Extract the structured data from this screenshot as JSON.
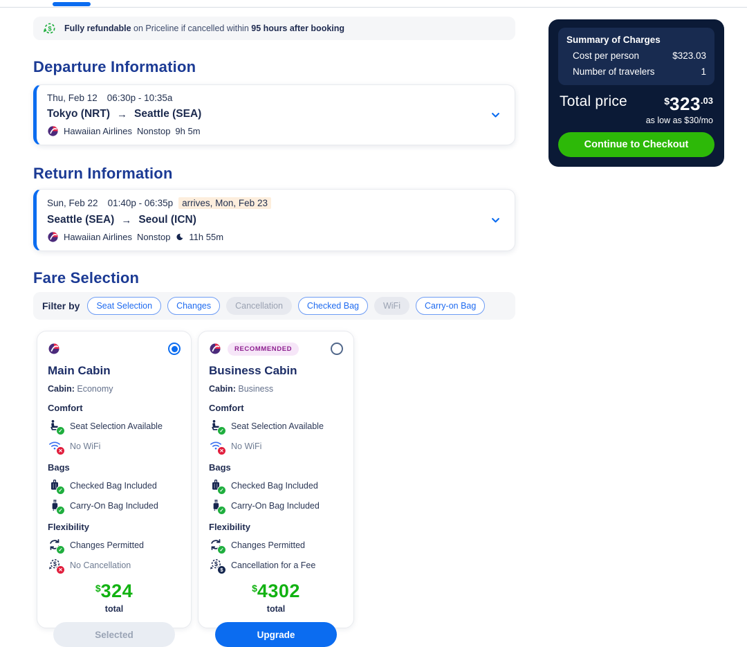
{
  "colors": {
    "accent_blue": "#0b6cf0",
    "heading_blue": "#1b3a94",
    "price_green": "#12b212",
    "cta_green": "#2db908",
    "summary_bg": "#0b1a36",
    "highlight_peach": "#fdeedd",
    "recommended_purple": "#8d1f8f"
  },
  "banner": {
    "bold_lead": "Fully refundable",
    "middle": "on Priceline if cancelled within",
    "bold_tail": "95 hours after booking"
  },
  "departure": {
    "heading": "Departure Information",
    "date": "Thu, Feb 12",
    "times": "06:30p - 10:35a",
    "origin": "Tokyo (NRT)",
    "arrow": "→",
    "destination": "Seattle (SEA)",
    "airline": "Hawaiian Airlines",
    "stops": "Nonstop",
    "duration": "9h 5m"
  },
  "return_info": {
    "heading": "Return Information",
    "date": "Sun, Feb 22",
    "times": "01:40p - 06:35p",
    "arrival_note": "arrives, Mon, Feb 23",
    "origin": "Seattle (SEA)",
    "arrow": "→",
    "destination": "Seoul (ICN)",
    "airline": "Hawaiian Airlines",
    "stops": "Nonstop",
    "duration": "11h 55m"
  },
  "fare_selection": {
    "heading": "Fare Selection",
    "filter_label": "Filter by",
    "filters": [
      {
        "label": "Seat Selection",
        "enabled": true
      },
      {
        "label": "Changes",
        "enabled": true
      },
      {
        "label": "Cancellation",
        "enabled": false
      },
      {
        "label": "Checked Bag",
        "enabled": true
      },
      {
        "label": "WiFi",
        "enabled": false
      },
      {
        "label": "Carry-on Bag",
        "enabled": true
      }
    ]
  },
  "fares": [
    {
      "name": "Main Cabin",
      "badge": "",
      "cabin_label": "Cabin:",
      "cabin_value": "Economy",
      "section_comfort": "Comfort",
      "section_bags": "Bags",
      "section_flexibility": "Flexibility",
      "seat": "Seat Selection Available",
      "wifi": "No WiFi",
      "checked_bag": "Checked Bag Included",
      "carry_on": "Carry-On Bag Included",
      "changes": "Changes Permitted",
      "cancellation": "No Cancellation",
      "price_currency": "$",
      "price": "324",
      "price_caption": "total",
      "button": "Selected",
      "selected": true
    },
    {
      "name": "Business Cabin",
      "badge": "RECOMMENDED",
      "cabin_label": "Cabin:",
      "cabin_value": "Business",
      "section_comfort": "Comfort",
      "section_bags": "Bags",
      "section_flexibility": "Flexibility",
      "seat": "Seat Selection Available",
      "wifi": "No WiFi",
      "checked_bag": "Checked Bag Included",
      "carry_on": "Carry-On Bag Included",
      "changes": "Changes Permitted",
      "cancellation": "Cancellation for a Fee",
      "price_currency": "$",
      "price": "4302",
      "price_caption": "total",
      "button": "Upgrade",
      "selected": false
    }
  ],
  "summary": {
    "title": "Summary of Charges",
    "rows": [
      {
        "label": "Cost per person",
        "value": "$323.03"
      },
      {
        "label": "Number of travelers",
        "value": "1"
      }
    ],
    "total_label": "Total price",
    "total_currency": "$",
    "total_amount": "323",
    "total_cents": ".03",
    "financing": "as low as $30/mo",
    "cta": "Continue to Checkout"
  }
}
